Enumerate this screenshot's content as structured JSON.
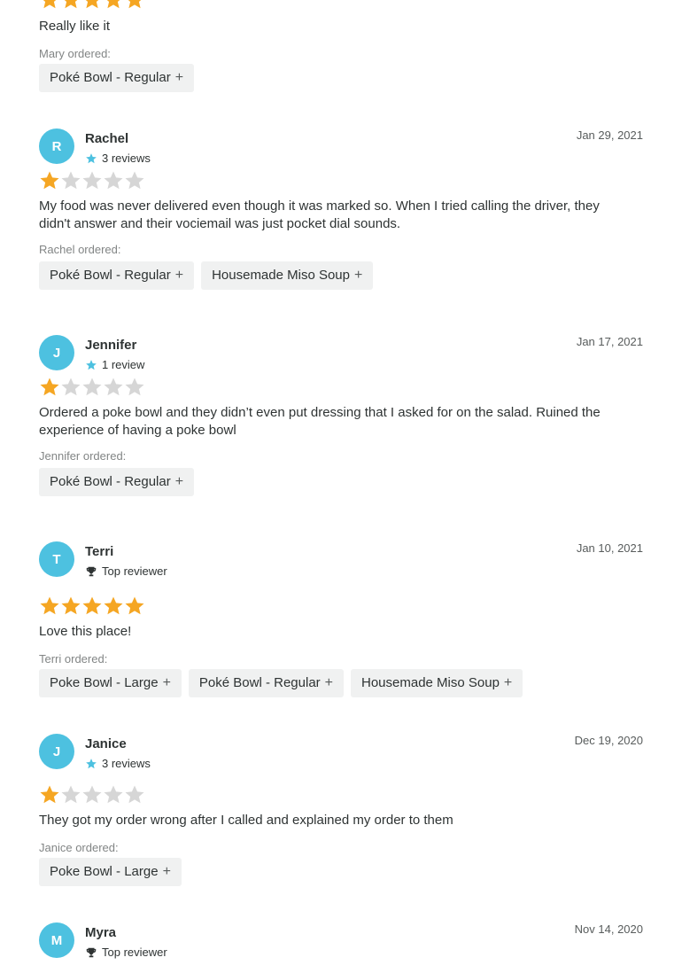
{
  "colors": {
    "star_filled": "#f5a623",
    "star_empty": "#d6d6d6",
    "avatar_bg": "#4dc1e0",
    "chip_bg": "#f0f1f1",
    "meta_star": "#4dc1e0"
  },
  "top_review": {
    "rating": 5,
    "text": "Really like it",
    "ordered_label": "Mary ordered:",
    "items": [
      "Poké Bowl - Regular"
    ]
  },
  "reviews": [
    {
      "initial": "R",
      "name": "Rachel",
      "meta_icon": "star-icon",
      "meta": "3 reviews",
      "date": "Jan 29, 2021",
      "rating": 1,
      "text": "My food was never delivered even though it was marked so. When I tried calling the driver, they didn't answer and their vociemail was just pocket dial sounds.",
      "ordered_label": "Rachel ordered:",
      "items": [
        "Poké Bowl - Regular",
        "Housemade Miso Soup"
      ]
    },
    {
      "initial": "J",
      "name": "Jennifer",
      "meta_icon": "star-icon",
      "meta": "1 review",
      "date": "Jan 17, 2021",
      "rating": 1,
      "text": "Ordered a poke bowl and they didn’t even put dressing that I asked for on the salad. Ruined the experience of having a poke bowl",
      "ordered_label": "Jennifer ordered:",
      "items": [
        "Poké Bowl - Regular"
      ]
    },
    {
      "initial": "T",
      "name": "Terri",
      "meta_icon": "trophy-icon",
      "meta": "Top reviewer",
      "date": "Jan 10, 2021",
      "rating": 5,
      "text": "Love this place!",
      "ordered_label": "Terri ordered:",
      "items": [
        "Poke Bowl - Large",
        "Poké Bowl - Regular",
        "Housemade Miso Soup"
      ]
    },
    {
      "initial": "J",
      "name": "Janice",
      "meta_icon": "star-icon",
      "meta": "3 reviews",
      "date": "Dec 19, 2020",
      "rating": 1,
      "text": "They got my order wrong after I called and explained my order to them",
      "ordered_label": "Janice ordered:",
      "items": [
        "Poke Bowl - Large"
      ]
    },
    {
      "initial": "M",
      "name": "Myra",
      "meta_icon": "trophy-icon",
      "meta": "Top reviewer",
      "date": "Nov 14, 2020",
      "rating": null,
      "text": "",
      "ordered_label": "",
      "items": []
    }
  ]
}
